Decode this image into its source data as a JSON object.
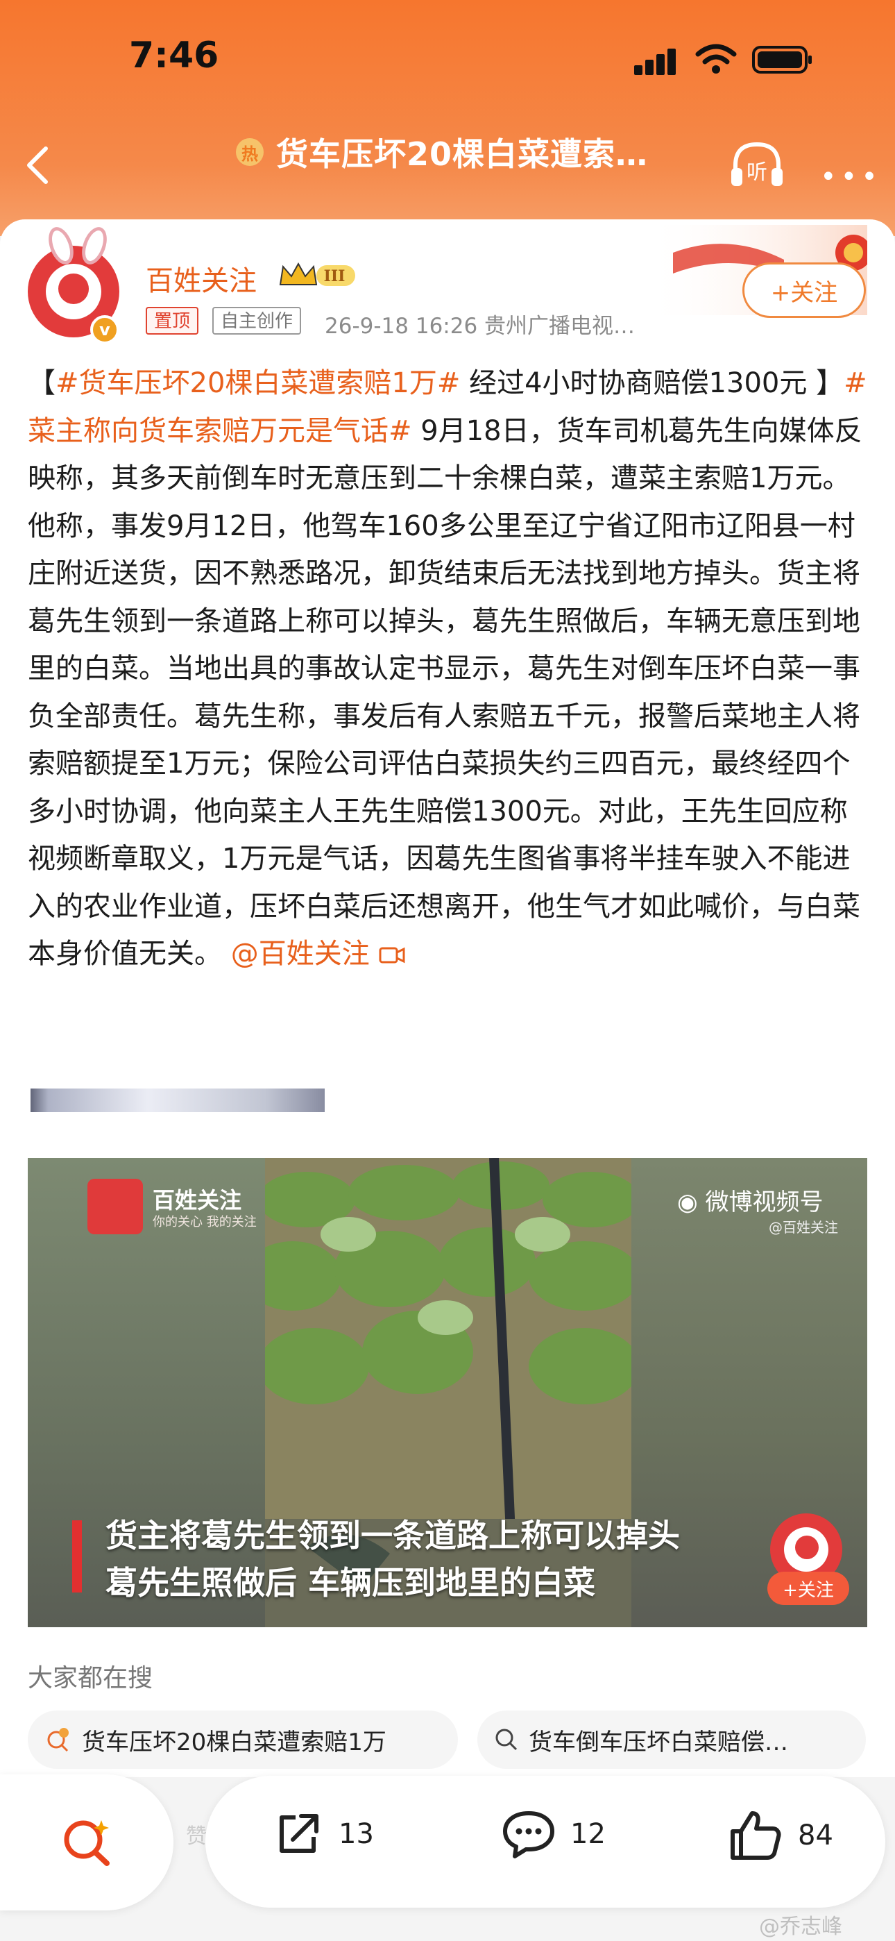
{
  "status_bar": {
    "time": "7:46"
  },
  "nav": {
    "hot_badge": "热",
    "title": "货车压坏20棵白菜遭索…",
    "listen": "听"
  },
  "post": {
    "author": "百姓关注",
    "level": "III",
    "v_badge": "v",
    "tag_pinned": "置顶",
    "tag_original": "自主创作",
    "meta": "26-9-18 16:26  贵州广播电视…",
    "follow_button": "+关注",
    "text": {
      "p1": "【",
      "link1": "#货车压坏20棵白菜遭索赔1万#",
      "p2": " 经过4小时协商赔偿1300元 】",
      "link2": "#菜主称向货车索赔万元是气话#",
      "p3": " 9月18日，货车司机葛先生向媒体反映称，其多天前倒车时无意压到二十余棵白菜，遭菜主索赔1万元。他称，事发9月12日，他驾车160多公里至辽宁省辽阳市辽阳县一村庄附近送货，因不熟悉路况，卸货结束后无法找到地方掉头。货主将葛先生领到一条道路上称可以掉头，葛先生照做后，车辆无意压到地里的白菜。当地出具的事故认定书显示，葛先生对倒车压坏白菜一事负全部责任。葛先生称，事发后有人索赔五千元，报警后菜地主人将索赔额提至1万元；保险公司评估白菜损失约三四百元，最终经四个多小时协调，他向菜主人王先生赔偿1300元。对此，王先生回应称视频断章取义，1万元是气话，因葛先生图省事将半挂车驶入不能进入的农业作业道，压坏白菜后还想离开，他生气才如此喊价，与白菜本身价值无关。",
      "mention": " @百姓关注"
    }
  },
  "video": {
    "brand_name": "百姓关注",
    "brand_sub": "你的关心 我的关注",
    "weibo_label": "微博视频号",
    "weibo_sub": "@百姓关注",
    "caption_line1": "货主将葛先生领到一条道路上称可以掉头",
    "caption_line2": "葛先生照做后 车辆压到地里的白菜",
    "follow_small": "+关注"
  },
  "search": {
    "title": "大家都在搜",
    "chips": [
      "货车压坏20棵白菜遭索赔1万",
      "货车倒车压坏白菜赔偿…"
    ]
  },
  "actions": {
    "zan": "赞",
    "share": "13",
    "comment": "12",
    "like": "84"
  },
  "watermark": "@乔志峰"
}
